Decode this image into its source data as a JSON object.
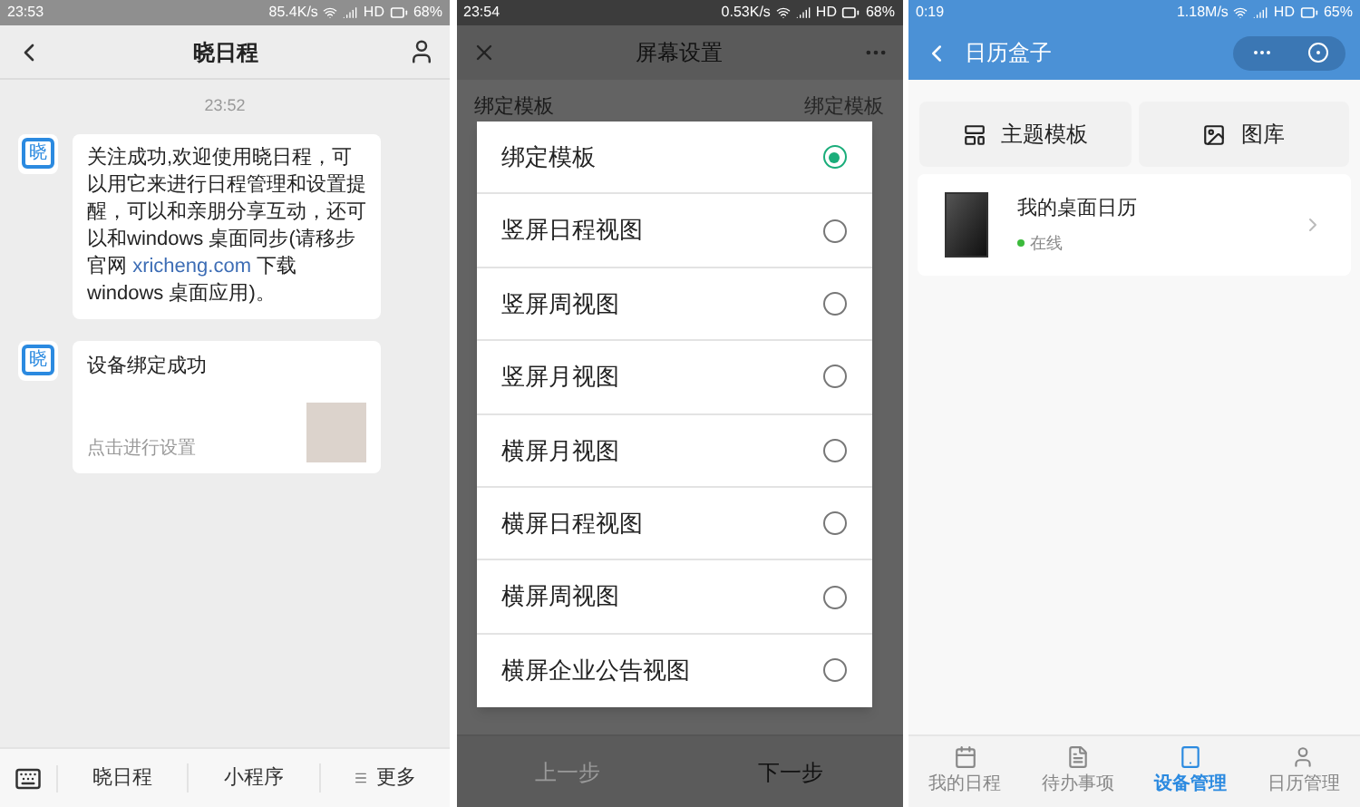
{
  "chat_screen": {
    "status_bar": {
      "time": "23:53",
      "speed": "85.4K/s",
      "network": "HD",
      "battery": "68%"
    },
    "header": {
      "title": "晓日程"
    },
    "timestamp": "23:52",
    "messages": [
      {
        "kind": "text",
        "avatar": "晓",
        "before": "关注成功,欢迎使用晓日程，可以用它来进行日程管理和设置提醒，可以和亲朋分享互动，还可以和windows 桌面同步(请移步官网 ",
        "link": "xricheng.com",
        "after": " 下载 windows 桌面应用)。"
      },
      {
        "kind": "card",
        "avatar": "晓",
        "title": "设备绑定成功",
        "subtitle": "点击进行设置"
      }
    ],
    "menu": [
      {
        "label": "晓日程",
        "kind": "plain"
      },
      {
        "label": "小程序",
        "kind": "plain"
      },
      {
        "label": "更多",
        "kind": "more"
      }
    ]
  },
  "settings_screen": {
    "status_bar": {
      "time": "23:54",
      "speed": "0.53K/s",
      "network": "HD",
      "battery": "68%"
    },
    "header": {
      "title": "屏幕设置"
    },
    "setting_row": {
      "label": "绑定模板",
      "value": "绑定模板"
    },
    "options": [
      {
        "label": "绑定模板",
        "selected": true
      },
      {
        "label": "竖屏日程视图",
        "selected": false
      },
      {
        "label": "竖屏周视图",
        "selected": false
      },
      {
        "label": "竖屏月视图",
        "selected": false
      },
      {
        "label": "横屏月视图",
        "selected": false
      },
      {
        "label": "横屏日程视图",
        "selected": false
      },
      {
        "label": "横屏周视图",
        "selected": false
      },
      {
        "label": "横屏企业公告视图",
        "selected": false
      }
    ],
    "footer": [
      {
        "label": "上一步",
        "disabled": true
      },
      {
        "label": "下一步",
        "disabled": false
      }
    ]
  },
  "device_screen": {
    "status_bar": {
      "time": "0:19",
      "speed": "1.18M/s",
      "network": "HD",
      "battery": "65%"
    },
    "header": {
      "title": "日历盒子"
    },
    "actions": [
      {
        "label": "主题模板",
        "kind": "template"
      },
      {
        "label": "图库",
        "kind": "gallery"
      }
    ],
    "device": {
      "name": "我的桌面日历",
      "status": "在线",
      "online": true
    },
    "tabs": [
      {
        "label": "我的日程",
        "kind": "calendar",
        "selected": false
      },
      {
        "label": "待办事项",
        "kind": "list",
        "selected": false
      },
      {
        "label": "设备管理",
        "kind": "device",
        "selected": true
      },
      {
        "label": "日历管理",
        "kind": "person",
        "selected": false
      }
    ]
  }
}
